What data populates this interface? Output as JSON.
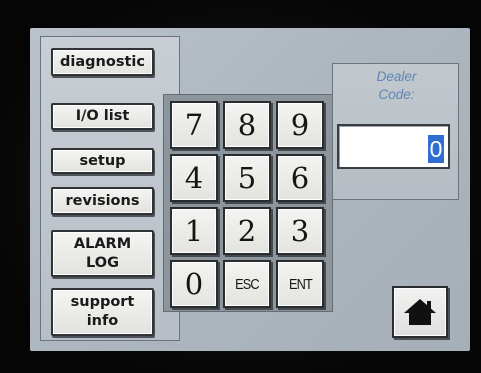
{
  "menu": {
    "items": [
      {
        "label": "diagnostic"
      },
      {
        "label": "I/O list"
      },
      {
        "label": "setup"
      },
      {
        "label": "revisions"
      },
      {
        "label": "ALARM\nLOG"
      },
      {
        "label": "support\ninfo"
      }
    ]
  },
  "keypad": {
    "keys": [
      {
        "label": "7"
      },
      {
        "label": "8"
      },
      {
        "label": "9"
      },
      {
        "label": "4"
      },
      {
        "label": "5"
      },
      {
        "label": "6"
      },
      {
        "label": "1"
      },
      {
        "label": "2"
      },
      {
        "label": "3"
      },
      {
        "label": "0"
      },
      {
        "label": "ESC"
      },
      {
        "label": "ENT"
      }
    ]
  },
  "dealer": {
    "label": "Dealer\nCode:",
    "value": "0"
  },
  "home": {
    "icon": "home-icon"
  },
  "colors": {
    "screen_bg": "#b0b9c2",
    "label_accent": "#5e86b4",
    "selection": "#2f6fd2"
  }
}
